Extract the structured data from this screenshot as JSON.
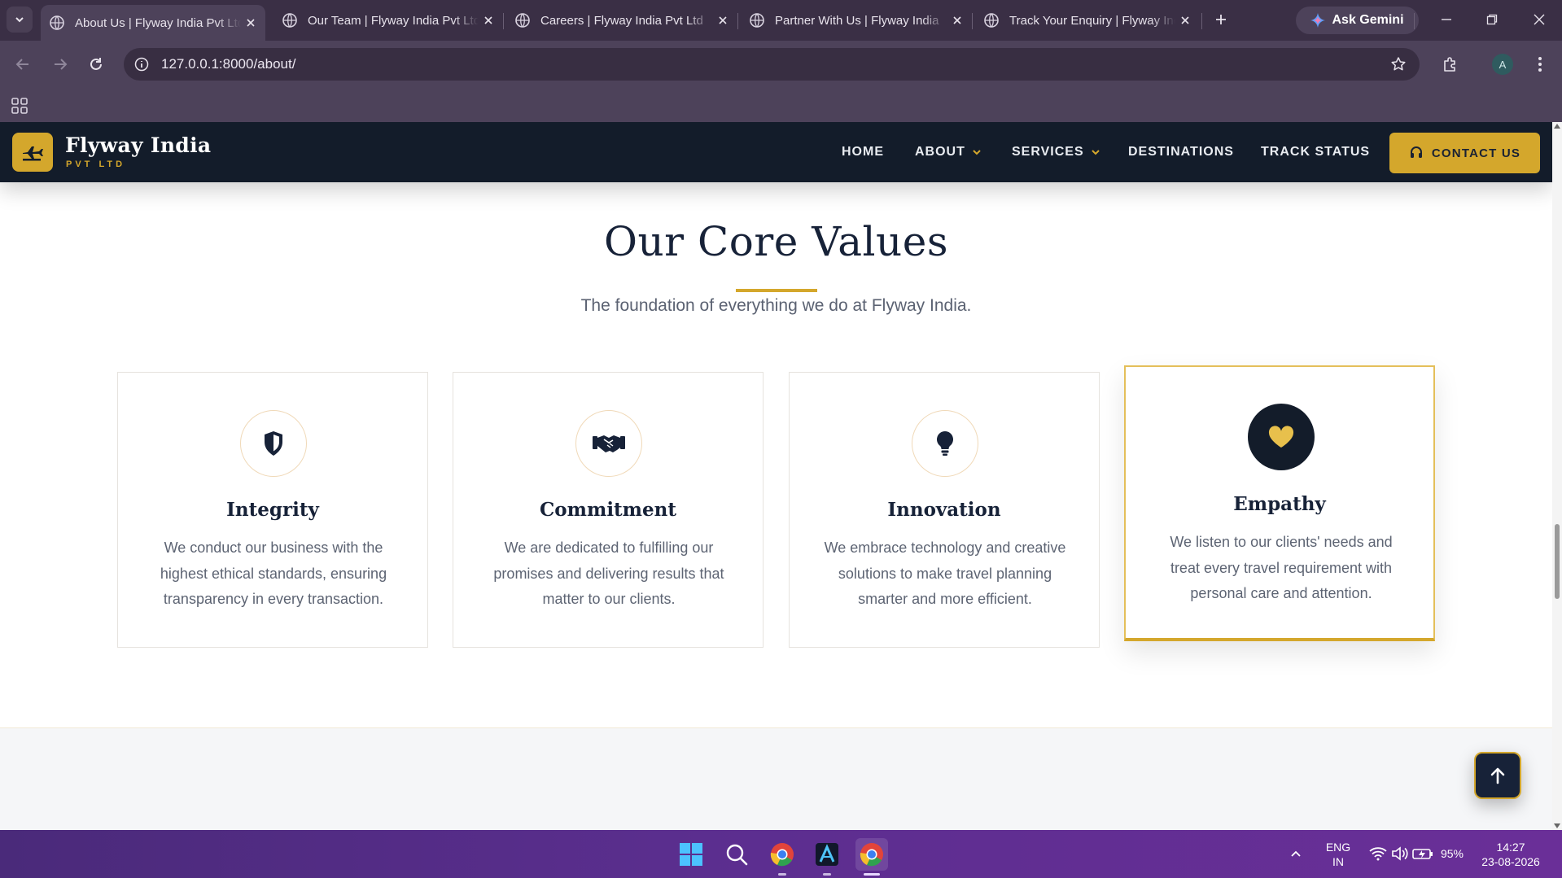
{
  "browser": {
    "tabs": [
      {
        "title": "About Us | Flyway India Pvt Ltd",
        "active": true
      },
      {
        "title": "Our Team | Flyway India Pvt Ltd",
        "active": false
      },
      {
        "title": "Careers | Flyway India Pvt Ltd",
        "active": false
      },
      {
        "title": "Partner With Us | Flyway India",
        "active": false
      },
      {
        "title": "Track Your Enquiry | Flyway India",
        "active": false
      }
    ],
    "gemini_label": "Ask Gemini",
    "url": "127.0.0.1:8000/about/",
    "profile_initial": "A"
  },
  "site": {
    "brand": "Flyway India",
    "brand_sub": "PVT LTD",
    "nav": {
      "home": "HOME",
      "about": "ABOUT",
      "services": "SERVICES",
      "destinations": "DESTINATIONS",
      "track": "TRACK STATUS",
      "contact": "CONTACT US"
    },
    "colors": {
      "accent": "#d4a72c",
      "navy": "#131c2a"
    }
  },
  "section": {
    "title": "Our Core Values",
    "subtitle": "The foundation of everything we do at Flyway India.",
    "cards": [
      {
        "icon": "shield-icon",
        "title": "Integrity",
        "text": "We conduct our business with the highest ethical standards, ensuring transparency in every transaction."
      },
      {
        "icon": "handshake-icon",
        "title": "Commitment",
        "text": "We are dedicated to fulfilling our promises and delivering results that matter to our clients."
      },
      {
        "icon": "lightbulb-icon",
        "title": "Innovation",
        "text": "We embrace technology and creative solutions to make travel planning smarter and more efficient."
      },
      {
        "icon": "heart-icon",
        "title": "Empathy",
        "text": "We listen to our clients' needs and treat every travel requirement with personal care and attention."
      }
    ]
  },
  "taskbar": {
    "lang": "ENG",
    "region": "IN",
    "battery": "95%",
    "time": "14:27",
    "date": "23-08-2026"
  }
}
